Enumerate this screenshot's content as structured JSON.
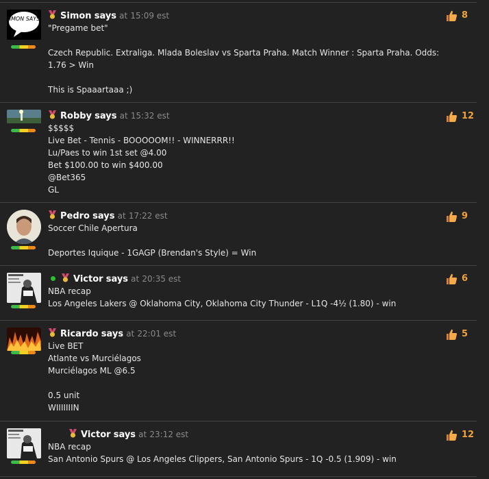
{
  "posts": [
    {
      "author": "Simon",
      "says": "says",
      "at": "at",
      "time": "15:09 est",
      "likes": "8",
      "online": false,
      "avatar_text": "SIMON SAYS!",
      "body": "\"Pregame bet\"\n\nCzech Republic. Extraliga. Mlada Boleslav vs Sparta Praha. Match Winner : Sparta Praha. Odds:\n1.76 > Win\n\nThis is Spaaartaaa ;)"
    },
    {
      "author": "Robby",
      "says": "says",
      "at": "at",
      "time": "15:32 est",
      "likes": "12",
      "online": false,
      "body": "$$$$$\nLive Bet - Tennis - BOOOOOM!! - WINNERRR!!\nLu/Paes to win 1st set @4.00\nBet $100.00 to win $400.00\n@Bet365\nGL"
    },
    {
      "author": "Pedro",
      "says": "says",
      "at": "at",
      "time": "17:22 est",
      "likes": "9",
      "online": false,
      "body": "Soccer Chile Apertura\n\nDeportes Iquique - 1GAGP (Brendan's Style) = Win"
    },
    {
      "author": "Victor",
      "says": "says",
      "at": "at",
      "time": "20:35 est",
      "likes": "6",
      "online": true,
      "body": "NBA recap\nLos Angeles Lakers @ Oklahoma City, Oklahoma City Thunder - L1Q -4½ (1.80) - win"
    },
    {
      "author": "Ricardo",
      "says": "says",
      "at": "at",
      "time": "22:01 est",
      "likes": "5",
      "online": false,
      "body": "Live BET\nAtlante vs Murciélagos\nMurciélagos ML @6.5\n\n0.5 unit\nWIIIIIIIN"
    },
    {
      "author": "Victor",
      "says": "says",
      "at": "at",
      "time": "23:12 est",
      "likes": "12",
      "online": false,
      "body": "NBA recap\nSan Antonio Spurs @ Los Angeles Clippers, San Antonio Spurs - 1Q -0.5 (1.909) - win"
    }
  ],
  "colors": {
    "background": "#222222",
    "like_count": "#f0a23a",
    "online": "#2ebf2e",
    "divider": "#444444"
  },
  "icons": {
    "like": "thumbs-up-icon",
    "medal": "medal-icon",
    "rank": "rank-bar"
  }
}
